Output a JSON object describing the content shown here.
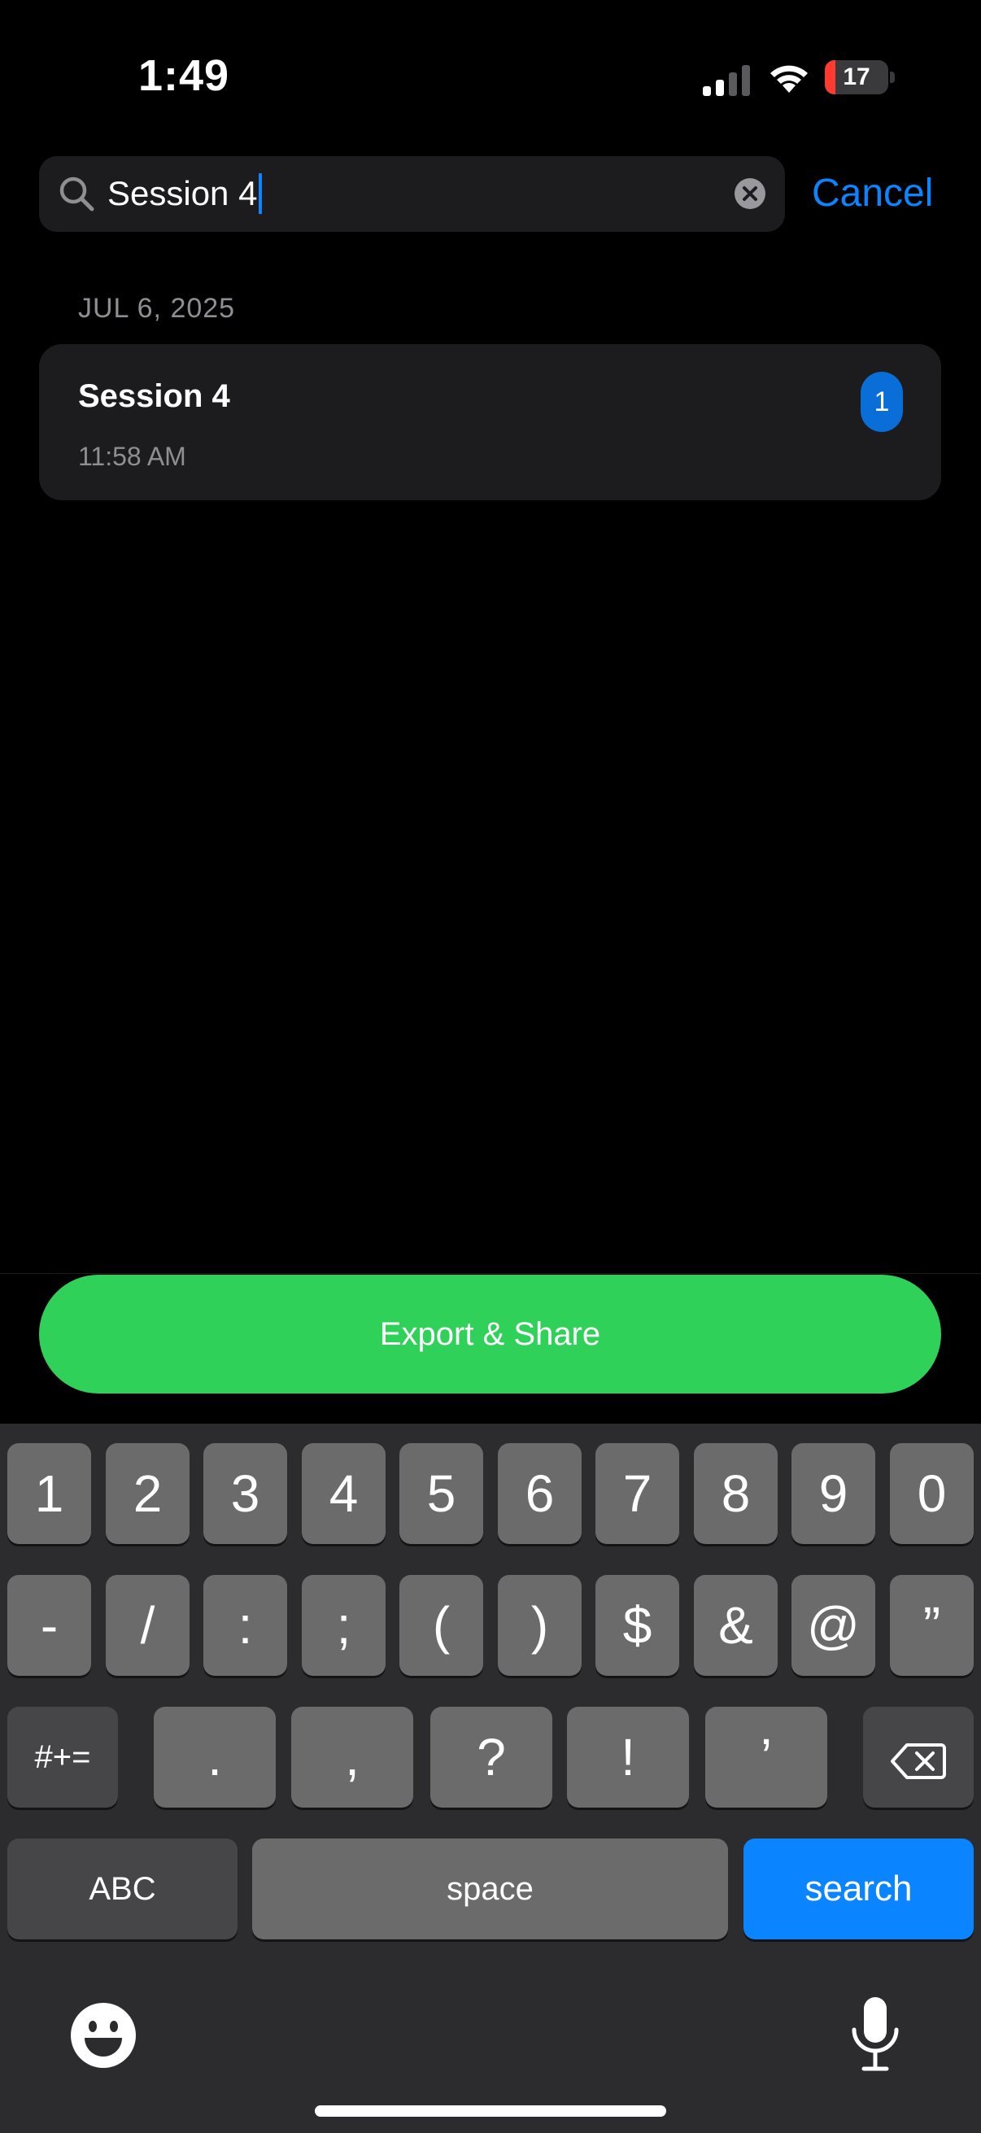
{
  "status_bar": {
    "time": "1:49",
    "battery_level": "17",
    "battery_fraction": 0.17,
    "icons": [
      "cellular-signal-icon",
      "wifi-icon",
      "battery-icon"
    ]
  },
  "search": {
    "value": "Session 4",
    "cancel_label": "Cancel",
    "accent_color": "#0a84ff"
  },
  "results": {
    "section_header": "JUL 6, 2025",
    "items": [
      {
        "title": "Session 4",
        "time": "11:58 AM",
        "badge": "1"
      }
    ]
  },
  "export": {
    "label": "Export & Share",
    "color": "#30d158"
  },
  "keyboard": {
    "row1": [
      "1",
      "2",
      "3",
      "4",
      "5",
      "6",
      "7",
      "8",
      "9",
      "0"
    ],
    "row2": [
      "-",
      "/",
      ":",
      ";",
      "(",
      ")",
      "$",
      "&",
      "@",
      "”"
    ],
    "row3": [
      "#+=",
      ".",
      ",",
      "?",
      "!",
      "’"
    ],
    "abc_label": "ABC",
    "space_label": "space",
    "search_label": "search",
    "icons": [
      "delete-icon",
      "emoji-icon",
      "microphone-icon"
    ]
  }
}
